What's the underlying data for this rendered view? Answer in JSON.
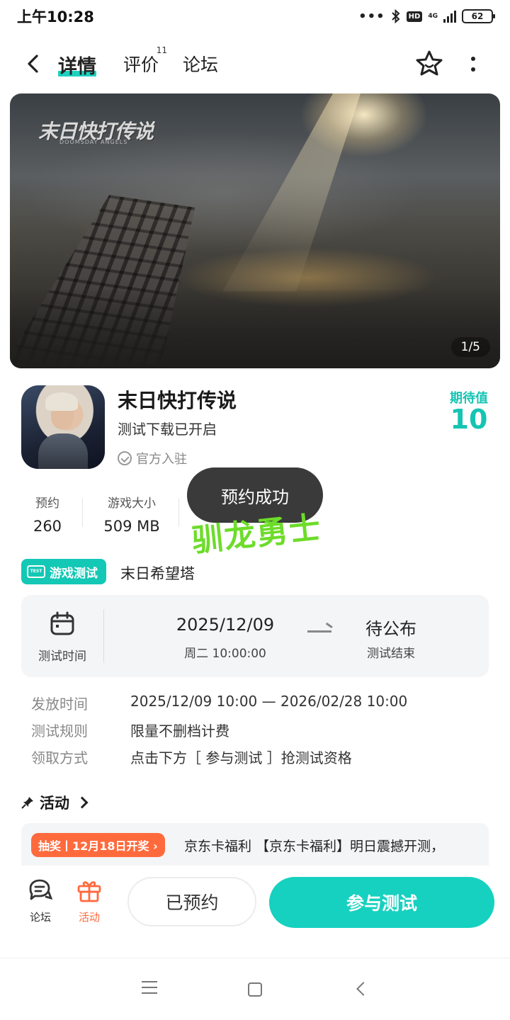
{
  "status_bar": {
    "time": "上午10:28",
    "dots": "•••",
    "hd": "HD",
    "network": "4G",
    "battery": "62"
  },
  "nav": {
    "tabs": [
      {
        "label": "详情",
        "active": true
      },
      {
        "label": "评价",
        "badge": "11"
      },
      {
        "label": "论坛"
      }
    ],
    "back_icon": "chevron-left-icon",
    "favorite_icon": "star-icon",
    "more_icon": "more-vertical-icon"
  },
  "banner": {
    "logo_text": "末日快打传说",
    "logo_sub": "DOOMSDAY ANGELS",
    "counter": "1/5"
  },
  "game": {
    "title": "末日快打传说",
    "subtitle": "测试下载已开启",
    "official": "官方入驻",
    "expect_label": "期待值",
    "expect_value": "10"
  },
  "stats": [
    {
      "label": "预约",
      "value": "260"
    },
    {
      "label": "游戏大小",
      "value": "509 MB"
    }
  ],
  "toast": "预约成功",
  "watermark": "驯龙勇士",
  "test": {
    "tag": "游戏测试",
    "tag_icon_text": "TEST",
    "name": "末日希望塔",
    "time_label": "测试时间",
    "start_date": "2025/12/09",
    "start_time": "周二  10:00:00",
    "end_date": "待公布",
    "end_label": "测试结束"
  },
  "details": [
    {
      "key": "发放时间",
      "value": "2025/12/09 10:00 — 2026/02/28 10:00"
    },
    {
      "key": "测试规则",
      "value": "限量不删档计费"
    },
    {
      "key": "领取方式",
      "value": "点击下方［ 参与测试 ］抢测试资格"
    }
  ],
  "activity": {
    "title": "活动",
    "badge": "抽奖丨12月18日开奖 ›",
    "text": "京东卡福利 【京东卡福利】明日震撼开测，"
  },
  "bottom_bar": {
    "forum_label": "论坛",
    "activity_label": "活动",
    "reserved_label": "已预约",
    "join_label": "参与测试"
  },
  "colors": {
    "accent": "#16d1bf",
    "orange": "#ff6a3d",
    "toast_bg": "#3a3a3a"
  }
}
